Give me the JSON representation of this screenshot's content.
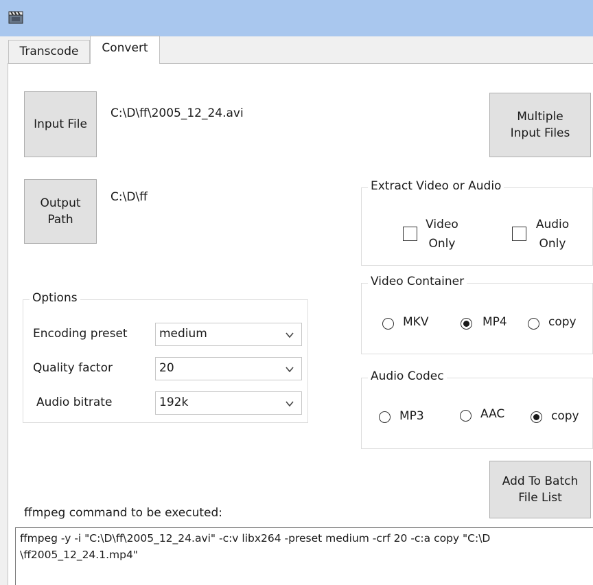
{
  "tabs": [
    {
      "label": "Transcode"
    },
    {
      "label": "Convert"
    }
  ],
  "input_file": {
    "button_label": "Input File",
    "path": "C:\\D\\ff\\2005_12_24.avi"
  },
  "multiple_input": {
    "button_label": "Multiple\nInput Files"
  },
  "output_path": {
    "button_label": "Output\nPath",
    "path": "C:\\D\\ff"
  },
  "extract": {
    "title": "Extract Video or Audio",
    "video_only_label": "Video\nOnly",
    "audio_only_label": "Audio\nOnly",
    "video_only_checked": false,
    "audio_only_checked": false
  },
  "options": {
    "title": "Options",
    "encoding_preset_label": "Encoding preset",
    "encoding_preset_value": "medium",
    "quality_factor_label": "Quality factor",
    "quality_factor_value": "20",
    "audio_bitrate_label": "Audio bitrate",
    "audio_bitrate_value": "192k"
  },
  "video_container": {
    "title": "Video Container",
    "options": [
      "MKV",
      "MP4",
      "copy"
    ],
    "selected": "MP4"
  },
  "audio_codec": {
    "title": "Audio Codec",
    "options": [
      "MP3",
      "AAC",
      "copy"
    ],
    "selected": "copy"
  },
  "batch": {
    "button_label": "Add To Batch\nFile List"
  },
  "command": {
    "label": "ffmpeg command to be executed:",
    "line1": "ffmpeg -y -i \"C:\\D\\ff\\2005_12_24.avi\" -c:v libx264 -preset medium -crf 20 -c:a copy \"C:\\D",
    "line2": "\\ff2005_12_24.1.mp4\""
  },
  "colors": {
    "titlebar": "#a9c7ee",
    "panel": "#ffffff",
    "button": "#e1e1e1"
  }
}
